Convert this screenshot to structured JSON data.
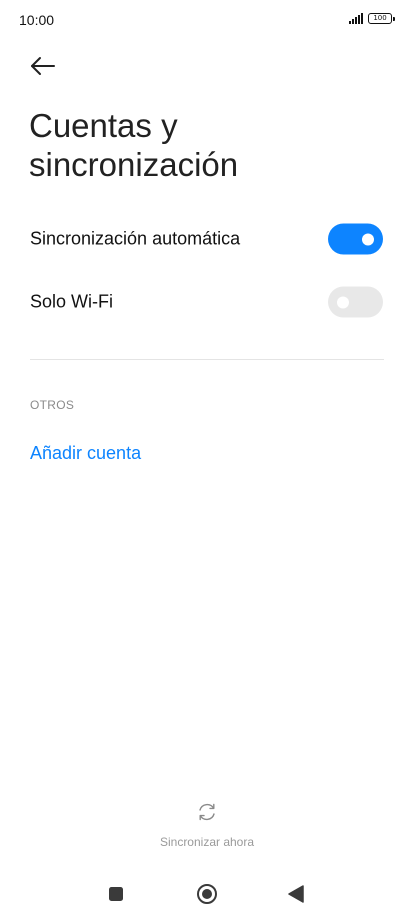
{
  "status_bar": {
    "time": "10:00",
    "battery": "100"
  },
  "header": {
    "back_icon": "arrow-left-icon",
    "title": "Cuentas y sincronización"
  },
  "settings": [
    {
      "label": "Sincronización automática",
      "toggle_on": true
    },
    {
      "label": "Solo Wi-Fi",
      "toggle_on": false
    }
  ],
  "others_section": {
    "header": "OTROS",
    "add_account_label": "Añadir cuenta"
  },
  "sync_now": {
    "icon": "sync-icon",
    "label": "Sincronizar ahora"
  },
  "nav_bar": {
    "recents_icon": "square-icon",
    "home_icon": "circle-icon",
    "back_icon": "triangle-back-icon"
  },
  "colors": {
    "accent": "#0d84ff",
    "toggle_off": "#e8e8e8",
    "secondary_text": "#8a8a8a"
  }
}
